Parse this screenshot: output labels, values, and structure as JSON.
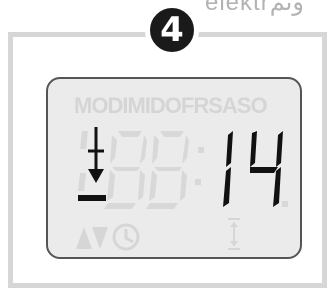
{
  "brand": {
    "text": "elektrونم"
  },
  "step": {
    "number": "4"
  },
  "lcd": {
    "weekdays": "MODIMIDOFRSASO",
    "ghost_time": "88:88.",
    "minutes_value": "14",
    "icons": {
      "down_arrow_icon": "arrow-down-to-line-icon",
      "up_down_icon": "up-down-triangles-icon",
      "clock_icon": "clock-icon",
      "limit_icon": "end-limit-icon"
    },
    "colors": {
      "segment_on": "#111111",
      "segment_ghost": "#d6d6d6",
      "background": "#ebebeb"
    }
  }
}
